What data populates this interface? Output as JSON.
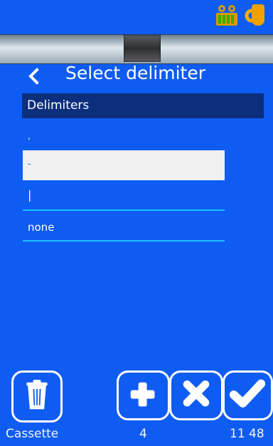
{
  "header": {
    "title": "Select delimiter"
  },
  "section": {
    "label": "Delimiters"
  },
  "list": {
    "items": [
      {
        "label": ","
      },
      {
        "label": "-"
      },
      {
        "label": "|"
      },
      {
        "label": "none"
      }
    ]
  },
  "footer": {
    "left": "Cassette",
    "center": "4",
    "right": "11 48"
  },
  "icons": {
    "status1": "cassette-icon",
    "status2": "ribbon-icon",
    "back": "chevron-left-icon",
    "trash": "trash-icon",
    "add": "plus-icon",
    "cancel": "x-icon",
    "confirm": "check-icon"
  },
  "colors": {
    "background": "#0f5cf2",
    "section_bg": "#0b2f7d",
    "selected_bg": "#f0f0f0",
    "line": "#19c2ff",
    "status_cassette": "#d39b00",
    "status_ribbon": "#f0a000"
  }
}
